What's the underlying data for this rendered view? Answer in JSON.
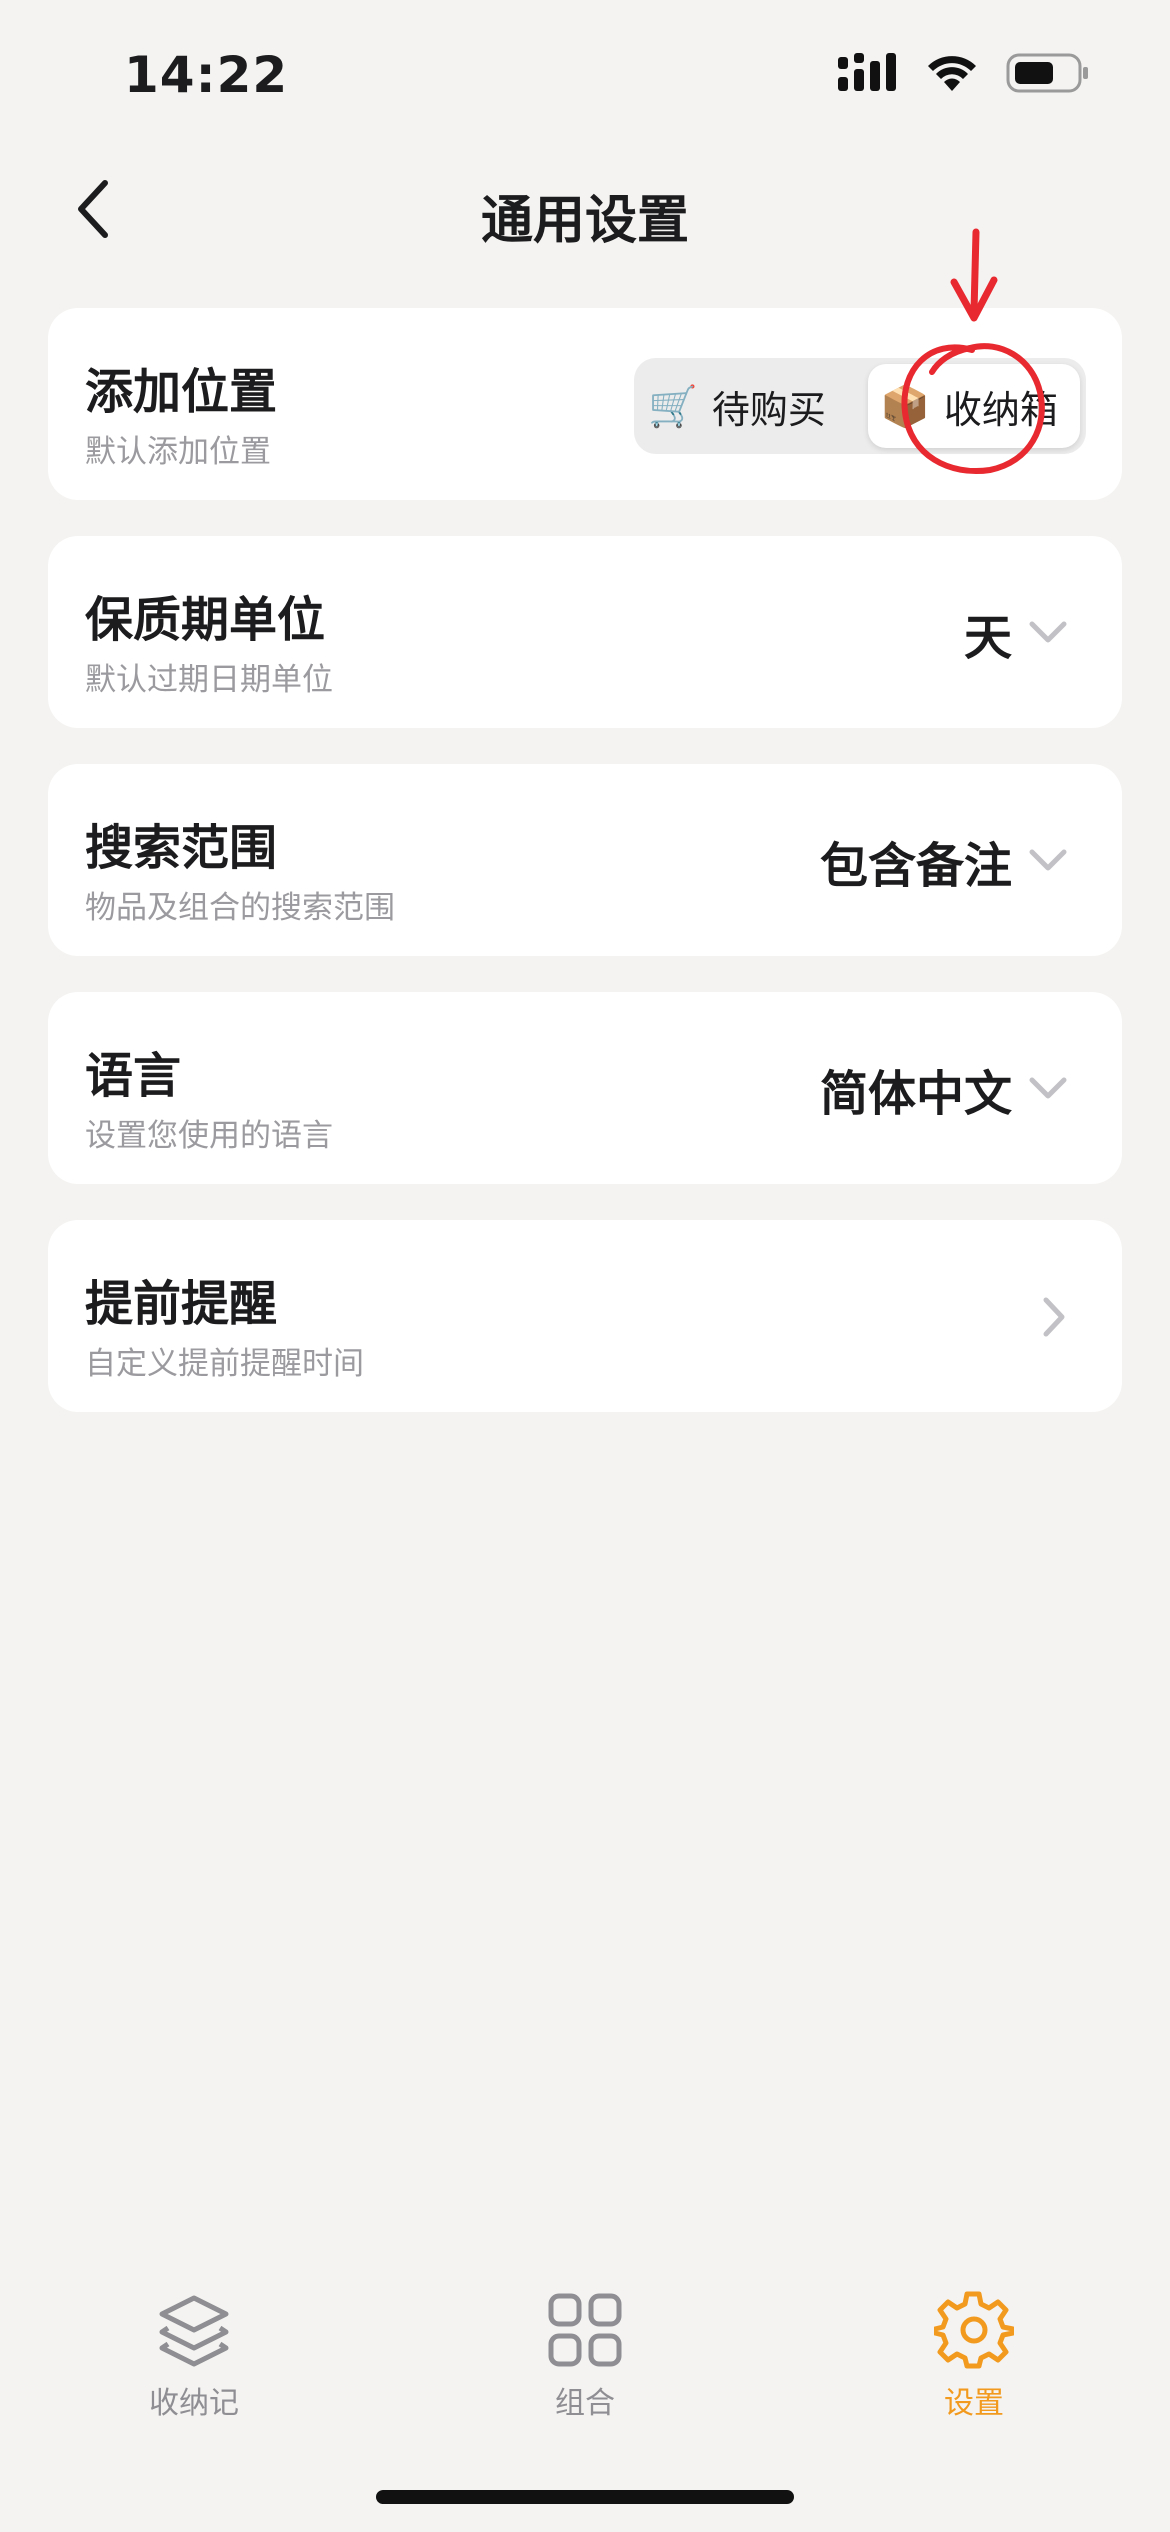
{
  "status": {
    "time": "14:22"
  },
  "nav": {
    "title": "通用设置"
  },
  "settings": {
    "add_location": {
      "title": "添加位置",
      "subtitle": "默认添加位置",
      "options": [
        {
          "emoji": "🛒",
          "label": "待购买",
          "selected": false
        },
        {
          "emoji": "📦",
          "label": "收纳箱",
          "selected": true
        }
      ]
    },
    "shelf_life_unit": {
      "title": "保质期单位",
      "subtitle": "默认过期日期单位",
      "value": "天"
    },
    "search_scope": {
      "title": "搜索范围",
      "subtitle": "物品及组合的搜索范围",
      "value": "包含备注"
    },
    "language": {
      "title": "语言",
      "subtitle": "设置您使用的语言",
      "value": "简体中文"
    },
    "reminder": {
      "title": "提前提醒",
      "subtitle": "自定义提前提醒时间"
    }
  },
  "tabbar": {
    "tabs": [
      {
        "label": "收纳记",
        "icon": "layers-icon",
        "active": false
      },
      {
        "label": "组合",
        "icon": "grid-icon",
        "active": false
      },
      {
        "label": "设置",
        "icon": "gear-icon",
        "active": true
      }
    ]
  },
  "colors": {
    "accent": "#f29a1e",
    "annotation": "#e8292f",
    "background": "#f4f3f1",
    "card": "#ffffff"
  }
}
